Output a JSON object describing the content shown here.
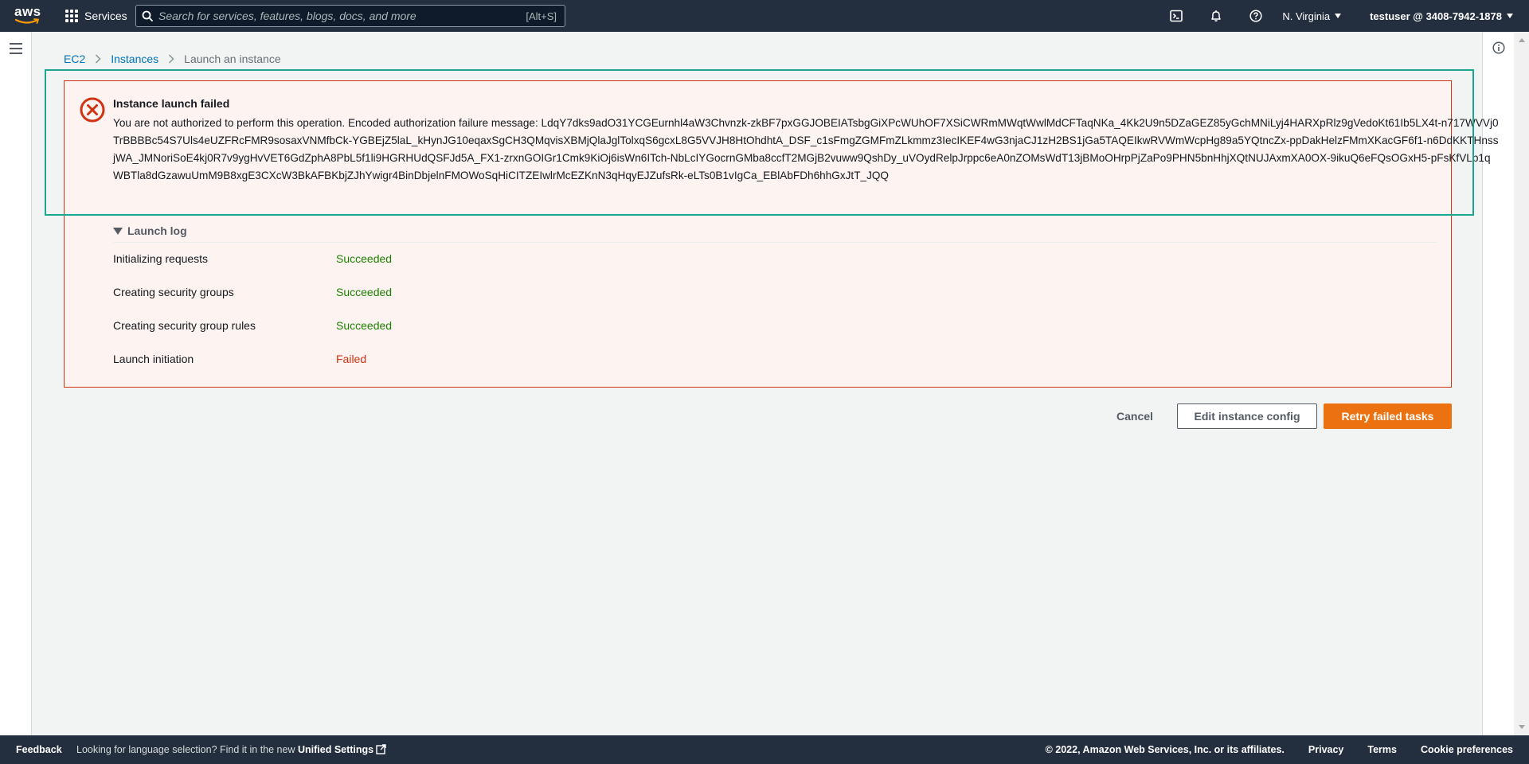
{
  "nav": {
    "logo_text": "aws",
    "services_label": "Services",
    "search_placeholder": "Search for services, features, blogs, docs, and more",
    "search_shortcut": "[Alt+S]",
    "region": "N. Virginia",
    "account": "testuser @ 3408-7942-1878"
  },
  "breadcrumb": {
    "items": [
      "EC2",
      "Instances",
      "Launch an instance"
    ]
  },
  "error": {
    "title": "Instance launch failed",
    "message": "You are not authorized to perform this operation. Encoded authorization failure message: LdqY7dks9adO31YCGEurnhl4aW3Chvnzk-zkBF7pxGGJOBEIATsbgGiXPcWUhOF7XSiCWRmMWqtWwlMdCFTaqNKa_4Kk2U9n5DZaGEZ85yGchMNiLyj4HARXpRlz9gVedoKt61Ib5LX4t-n717WVVj0TrBBBBc54S7Uls4eUZFRcFMR9sosaxVNMfbCk-YGBEjZ5laL_kHynJG10eqaxSgCH3QMqvisXBMjQlaJglTolxqS6gcxL8G5VVJH8HtOhdhtA_DSF_c1sFmgZGMFmZLkmmz3IecIKEF4wG3njaCJ1zH2BS1jGa5TAQEIkwRVWmWcpHg89a5YQtncZx-ppDakHelzFMmXKacGF6f1-n6DdKKTHnssjWA_JMNoriSoE4kj0R7v9ygHvVET6GdZphA8PbL5f1li9HGRHUdQSFJd5A_FX1-zrxnGOIGr1Cmk9KiOj6isWn6ITch-NbLcIYGocrnGMba8ccfT2MGjB2vuww9QshDy_uVOydRelpJrppc6eA0nZOMsWdT13jBMoOHrpPjZaPo9PHN5bnHhjXQtNUJAxmXA0OX-9ikuQ6eFQsOGxH5-pFsKfVLp1qWBTla8dGzawuUmM9B8xgE3CXcW3BkAFBKbjZJhYwigr4BinDbjelnFMOWoSqHiCITZEIwlrMcEZKnN3qHqyEJZufsRk-eLTs0B1vIgCa_EBlAbFDh6hhGxJtT_JQQ",
    "log_label": "Launch log",
    "log": [
      {
        "step": "Initializing requests",
        "status": "Succeeded"
      },
      {
        "step": "Creating security groups",
        "status": "Succeeded"
      },
      {
        "step": "Creating security group rules",
        "status": "Succeeded"
      },
      {
        "step": "Launch initiation",
        "status": "Failed"
      }
    ]
  },
  "actions": {
    "cancel": "Cancel",
    "edit": "Edit instance config",
    "retry": "Retry failed tasks"
  },
  "footer": {
    "feedback": "Feedback",
    "lang_prefix": "Looking for language selection? Find it in the new",
    "lang_link": "Unified Settings",
    "copyright": "© 2022, Amazon Web Services, Inc. or its affiliates.",
    "privacy": "Privacy",
    "terms": "Terms",
    "cookies": "Cookie preferences"
  },
  "colors": {
    "nav_bg": "#232f3e",
    "error_border": "#d13212",
    "error_bg": "#fdf3f1",
    "success": "#1d8102",
    "primary_button": "#ec7211",
    "link": "#0073bb",
    "focus_ring": "#1aa68f"
  },
  "icons": [
    "apps-grid-icon",
    "search-icon",
    "cloudshell-icon",
    "bell-icon",
    "help-icon",
    "hamburger-icon",
    "info-icon",
    "error-icon",
    "external-link-icon",
    "chevron-right-icon"
  ]
}
